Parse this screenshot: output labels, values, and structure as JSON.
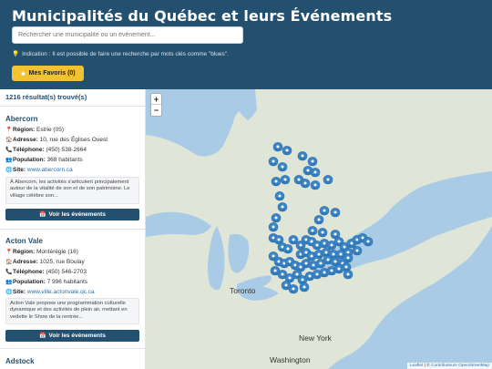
{
  "header": {
    "title": "Municipalités du Québec et leurs Événements",
    "search_placeholder": "Rechercher une municipalité ou un événement...",
    "hint": "Indication : Il est possible de faire une recherche par mots clés comme \"blues\".",
    "favorites_label": "Mes Favoris (0)"
  },
  "results": {
    "count_label": "1216 résultat(s) trouvé(s)"
  },
  "cards": [
    {
      "name": "Abercorn",
      "region_label": "Région:",
      "region": "Estrie (05)",
      "address_label": "Adresse:",
      "address": "10, rue des Églises Ouest",
      "phone_label": "Téléphone:",
      "phone": "(450) 538-2664",
      "population_label": "Population:",
      "population": "368 habitants",
      "site_label": "Site:",
      "site": "www.abercorn.ca",
      "description": "À Abercorn, les activités s'articulent principalement autour de la vitalité de son et de son patrimoine. Le village célèbre son...",
      "events_label": "Voir les événements"
    },
    {
      "name": "Acton Vale",
      "region_label": "Région:",
      "region": "Montérégie (16)",
      "address_label": "Adresse:",
      "address": "1025, rue Boulay",
      "phone_label": "Téléphone:",
      "phone": "(450) 546-2703",
      "population_label": "Population:",
      "population": "7 996 habitants",
      "site_label": "Site:",
      "site": "www.ville.actonvale.qc.ca",
      "description": "Acton Vale propose une programmation culturelle dynamique et des activités de plein air, mettant en vedette le Show de la rentrée...",
      "events_label": "Voir les événements"
    },
    {
      "name": "Adstock"
    }
  ],
  "map": {
    "zoom_in": "+",
    "zoom_out": "−",
    "labels": {
      "toronto": "Toronto",
      "new_york": "New York",
      "washington": "Washington"
    },
    "attribution_leaflet": "Leaflet",
    "attribution_sep": " | © ",
    "attribution_osm": "Contributeurs OpenStreetMap",
    "colors": {
      "marker": "#3a86c8",
      "water": "#a9cbe6",
      "land": "#dfe6d8",
      "header": "#24506f",
      "favorites": "#f1c232"
    }
  }
}
